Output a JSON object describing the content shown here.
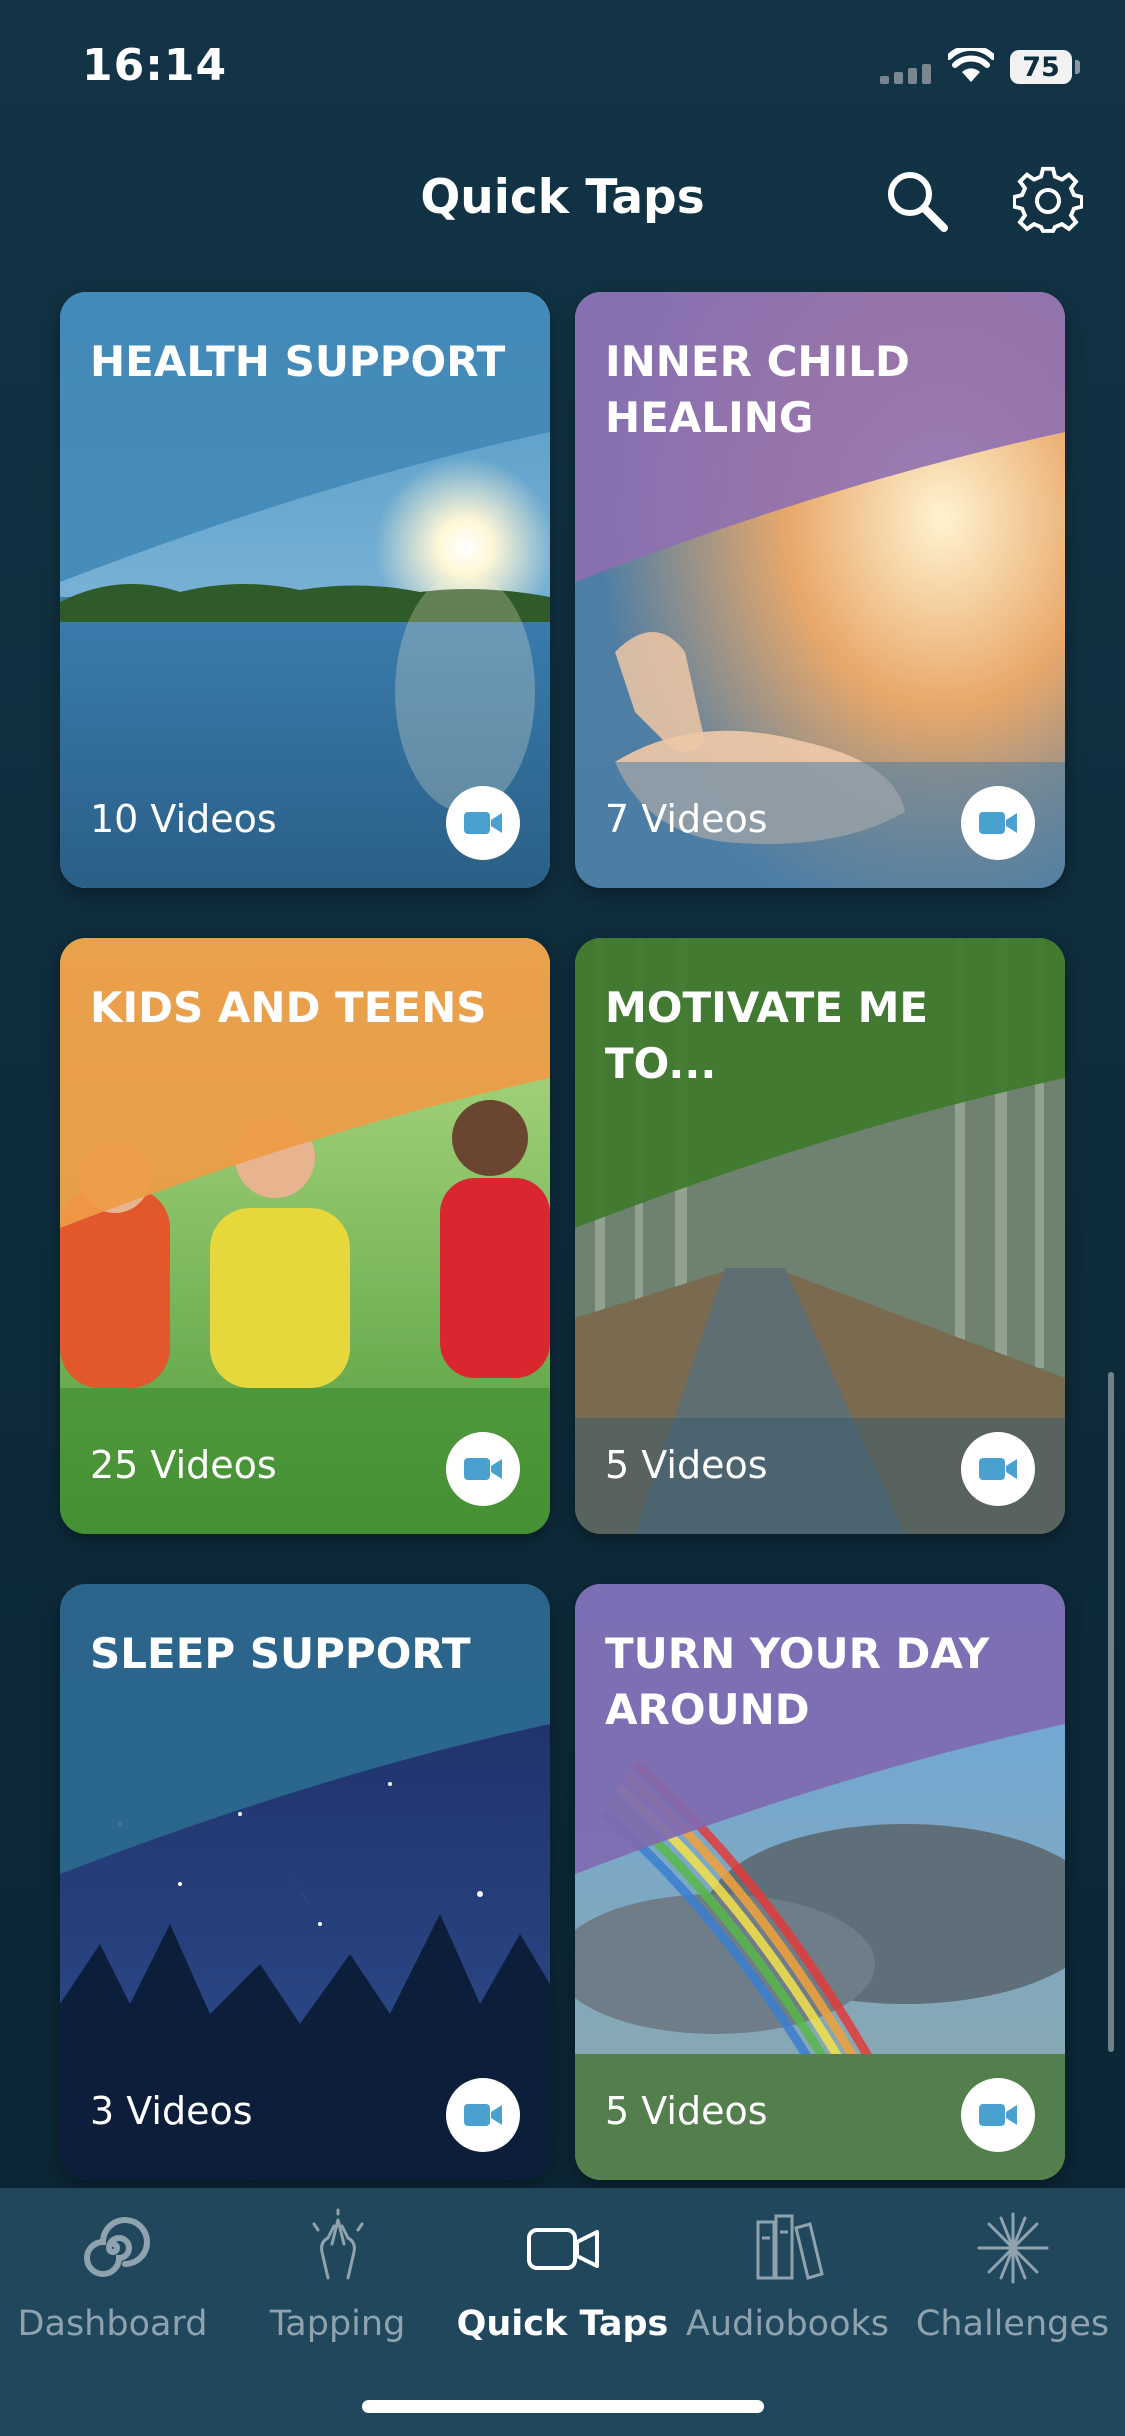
{
  "status_bar": {
    "time": "16:14",
    "battery": "75"
  },
  "header": {
    "title": "Quick Taps"
  },
  "cards": [
    {
      "title": "HEALTH SUPPORT",
      "count": "10 Videos",
      "top_color": "#3f87b6",
      "accent": "#3a9bd1"
    },
    {
      "title": "INNER CHILD HEALING",
      "count": "7 Videos",
      "top_color": "#8e6fb1",
      "accent": "#e8a05a"
    },
    {
      "title": "KIDS AND TEENS",
      "count": "25 Videos",
      "top_color": "#ef9b45",
      "accent": "#62a847"
    },
    {
      "title": "MOTIVATE ME TO...",
      "count": "5 Videos",
      "top_color": "#3f7a2c",
      "accent": "#6a7f8a"
    },
    {
      "title": "SLEEP SUPPORT",
      "count": "3 Videos",
      "top_color": "#2c6a8f",
      "accent": "#1b2f66"
    },
    {
      "title": "TURN YOUR DAY AROUND",
      "count": "5 Videos",
      "top_color": "#7f6ab1",
      "accent": "#6b8d64"
    }
  ],
  "tabs": [
    {
      "label": "Dashboard",
      "icon": "spiral-icon",
      "active": false
    },
    {
      "label": "Tapping",
      "icon": "hands-icon",
      "active": false
    },
    {
      "label": "Quick Taps",
      "icon": "video-camera-icon",
      "active": true
    },
    {
      "label": "Audiobooks",
      "icon": "books-icon",
      "active": false
    },
    {
      "label": "Challenges",
      "icon": "star-burst-icon",
      "active": false
    }
  ],
  "colors": {
    "background": "#123446",
    "tabbar": "#21475c",
    "video_icon": "#4aa0cf"
  }
}
